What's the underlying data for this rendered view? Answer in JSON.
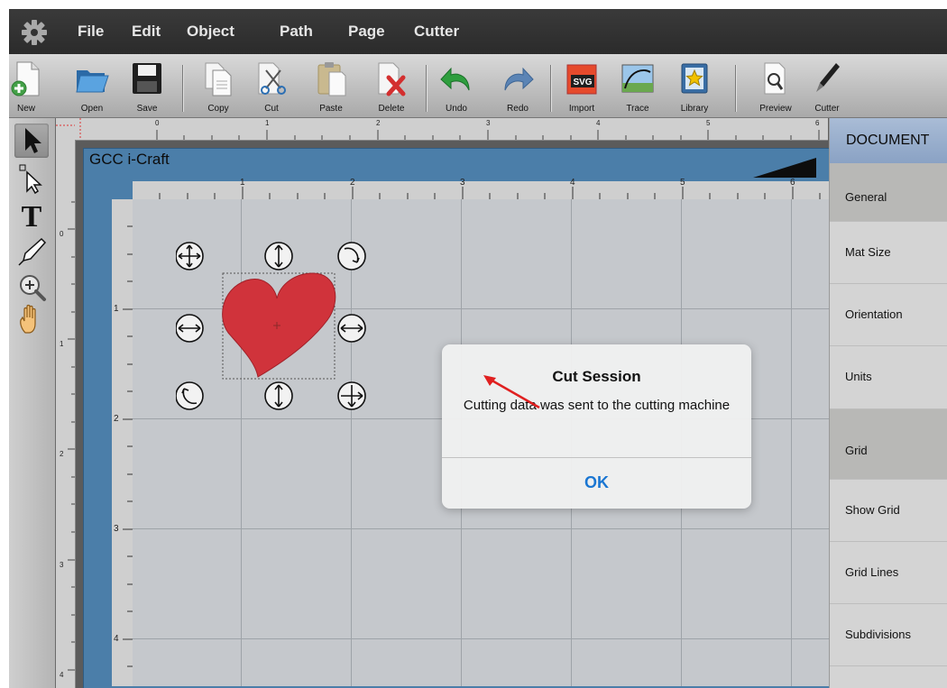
{
  "menubar": {
    "icon": "gear-icon",
    "items": [
      "File",
      "Edit",
      "Object",
      "Path",
      "Page",
      "Cutter"
    ]
  },
  "toolbar": {
    "new": "New",
    "open": "Open",
    "save": "Save",
    "copy": "Copy",
    "cut": "Cut",
    "paste": "Paste",
    "delete": "Delete",
    "undo": "Undo",
    "redo": "Redo",
    "import": "Import",
    "import_badge": "SVG",
    "trace": "Trace",
    "library": "Library",
    "preview": "Preview",
    "cutter": "Cutter"
  },
  "tools": [
    "select-arrow-icon",
    "node-select-icon",
    "text-tool-icon",
    "pen-tool-icon",
    "zoom-icon",
    "hand-pan-icon"
  ],
  "rulers": {
    "outer_h": [
      "0",
      "1",
      "2",
      "3",
      "4",
      "5",
      "6"
    ],
    "outer_v": [
      "0",
      "1",
      "2",
      "3",
      "4"
    ],
    "inner_h": [
      "1",
      "2",
      "3",
      "4",
      "5",
      "6"
    ],
    "inner_v": [
      "1",
      "2",
      "3",
      "4"
    ]
  },
  "canvas": {
    "mat_title": "GCC i-Craft",
    "shape": "heart",
    "shape_color": "#d0333b",
    "mat_color": "#4b7ea9"
  },
  "right_panel": {
    "header": "DOCUMENT",
    "items": [
      "General",
      "Mat Size",
      "Orientation",
      "Units",
      "Grid",
      "Show Grid",
      "Grid Lines",
      "Subdivisions"
    ]
  },
  "dialog": {
    "title": "Cut Session",
    "message": "Cutting data was sent to the cutting machine",
    "ok": "OK"
  },
  "colors": {
    "accent": "#1a76d2",
    "annotation_arrow": "#e02020"
  }
}
